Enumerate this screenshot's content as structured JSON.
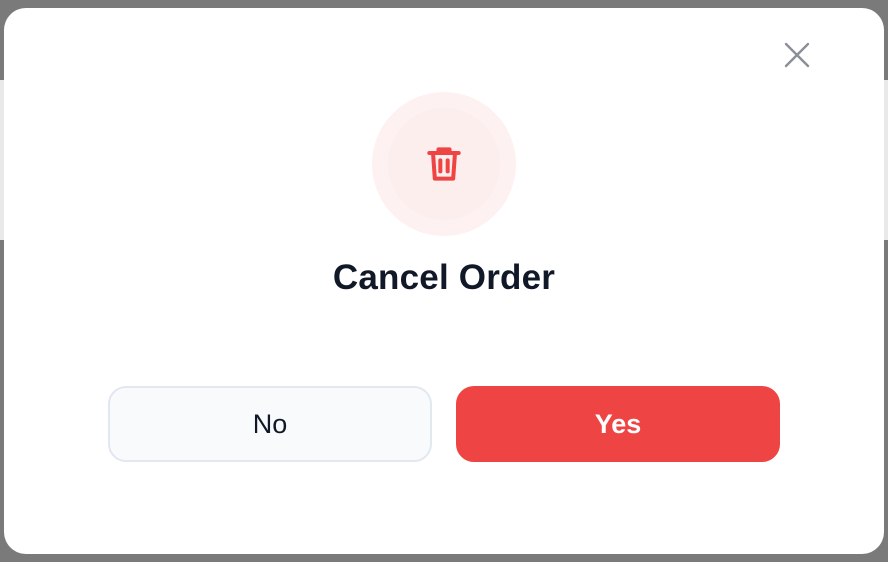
{
  "dialog": {
    "title": "Cancel Order",
    "no_label": "No",
    "yes_label": "Yes",
    "icon": "trash-icon",
    "close_icon": "close-icon"
  },
  "colors": {
    "danger": "#ef4444",
    "icon_bg": "#fdf1f1",
    "title_text": "#111827",
    "secondary_bg": "#f8fafc",
    "secondary_border": "#e2e8f0"
  }
}
